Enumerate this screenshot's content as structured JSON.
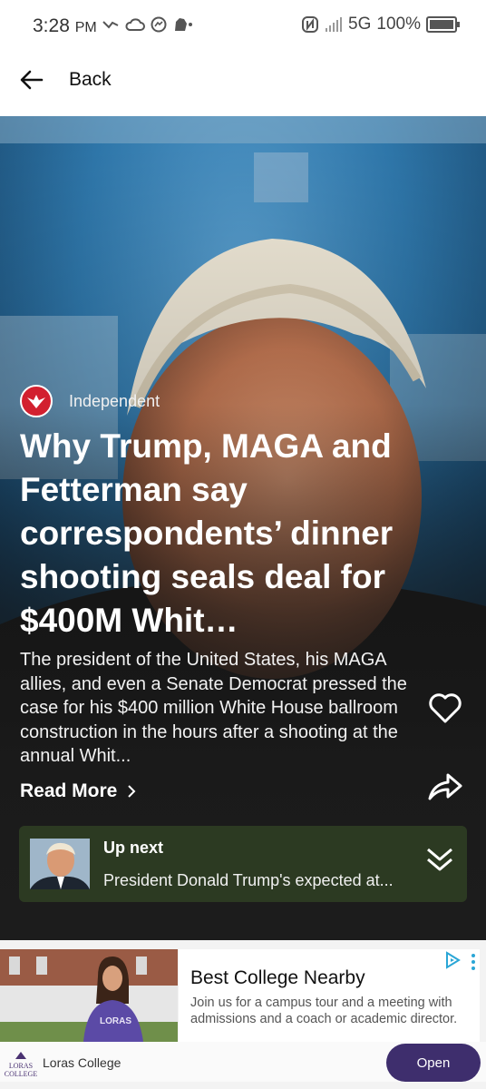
{
  "status_bar": {
    "time": "3:28",
    "time_suffix": "PM",
    "network": "5G",
    "battery": "100%"
  },
  "header": {
    "back_label": "Back"
  },
  "article": {
    "source": "Independent",
    "headline": "Why Trump, MAGA and Fetterman say correspondents’ dinner shooting seals deal for $400M Whit…",
    "summary": "The president of the United States, his MAGA allies, and even a Senate Democrat pressed the case for his $400 million White House ballroom construction in the hours after a shooting at the annual Whit...",
    "read_more": "Read More"
  },
  "up_next": {
    "title": "Up next",
    "text": "President Donald Trump's expected at..."
  },
  "ad": {
    "title": "Best College Nearby",
    "body": "Join us for a campus tour and a meeting with admissions and a coach or academic director.",
    "advertiser": "Loras College",
    "cta": "Open",
    "logo_text_top": "LORAS",
    "logo_text_bottom": "COLLEGE",
    "shirt_text": "LORAS"
  },
  "colors": {
    "up_next_bg": "#2c3a22",
    "source_logo": "#d2202f",
    "cta_bg": "#3e2e6d"
  }
}
